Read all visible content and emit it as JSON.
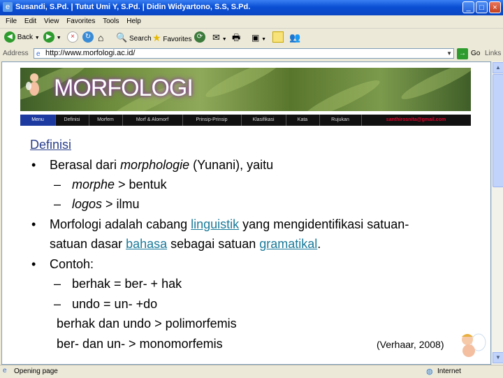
{
  "window": {
    "title": "Susandi, S.Pd. | Tutut Umi Y, S.Pd. | Didin Widyartono, S.S, S.Pd."
  },
  "menu": [
    "File",
    "Edit",
    "View",
    "Favorites",
    "Tools",
    "Help"
  ],
  "toolbar": {
    "back_label": "Back",
    "search_label": "Search",
    "favorites_label": "Favorites"
  },
  "address": {
    "label": "Address",
    "url": "http://www.morfologi.ac.id/",
    "go_label": "Go",
    "links_label": "Links"
  },
  "page": {
    "banner_title": "MORFOLOGI",
    "nav": [
      "Menu",
      "Definisi",
      "Morfem",
      "Morf & Alomorf",
      "Prinsip-Prinsip",
      "Klasifikasi",
      "Kata",
      "Rujukan"
    ],
    "email": "santhirosnita@gmail.com",
    "heading": "Definisi",
    "bullet1_a": "Berasal dari ",
    "bullet1_b": "morphologie",
    "bullet1_c": " (Yunani), yaitu",
    "sub1_a": "morphe",
    "sub1_b": " > bentuk",
    "sub2_a": "logos",
    "sub2_b": " > ilmu",
    "bullet2_a": "Morfologi adalah cabang ",
    "bullet2_link1": "linguistik",
    "bullet2_b": " yang mengidentifikasi satuan-",
    "bullet2_c": "satuan dasar ",
    "bullet2_link2": "bahasa",
    "bullet2_d": " sebagai satuan ",
    "bullet2_link3": "gramatikal",
    "bullet2_e": ".",
    "bullet3": "Contoh:",
    "ex1": "berhak = ber- + hak",
    "ex2": "undo = un- +do",
    "ex3": "berhak dan undo > polimorfemis",
    "ex4": "ber- dan un- > monomorfemis",
    "citation": "(Verhaar, 2008)"
  },
  "status": {
    "left": "Opening page",
    "right": "Internet"
  }
}
